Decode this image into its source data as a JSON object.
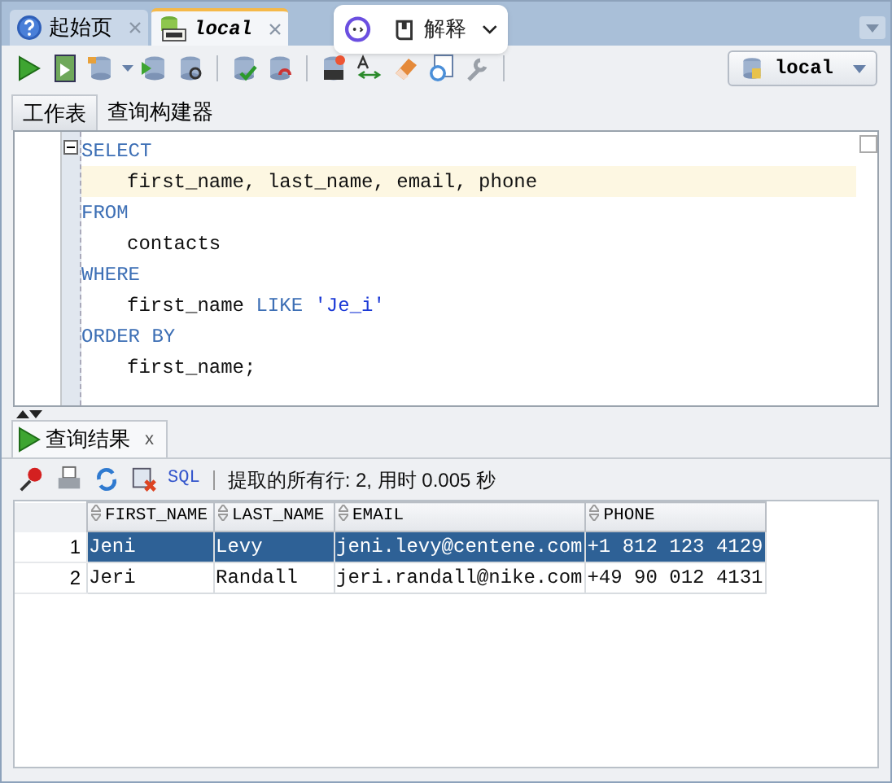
{
  "editor_tabs": [
    {
      "label": "起始页",
      "kind": "help",
      "selected": false
    },
    {
      "label": "local",
      "kind": "sql",
      "selected": true
    }
  ],
  "overlay_popup": {
    "label": "解释"
  },
  "connection": {
    "label": "local"
  },
  "sub_tabs": [
    {
      "label": "工作表",
      "selected": true
    },
    {
      "label": "查询构建器",
      "selected": false
    }
  ],
  "code_lines": [
    {
      "indented": false,
      "current": false,
      "segments": [
        {
          "text": "SELECT",
          "kind": "keyword"
        }
      ]
    },
    {
      "indented": true,
      "current": true,
      "segments": [
        {
          "text": "first_name, last_name, email, phone",
          "kind": "plain"
        }
      ]
    },
    {
      "indented": false,
      "current": false,
      "segments": [
        {
          "text": "FROM",
          "kind": "keyword"
        }
      ]
    },
    {
      "indented": true,
      "current": false,
      "segments": [
        {
          "text": "contacts",
          "kind": "plain"
        }
      ]
    },
    {
      "indented": false,
      "current": false,
      "segments": [
        {
          "text": "WHERE",
          "kind": "keyword"
        }
      ]
    },
    {
      "indented": true,
      "current": false,
      "segments": [
        {
          "text": "first_name ",
          "kind": "plain"
        },
        {
          "text": "LIKE ",
          "kind": "keyword"
        },
        {
          "text": "'Je_i'",
          "kind": "string"
        }
      ]
    },
    {
      "indented": false,
      "current": false,
      "segments": [
        {
          "text": "ORDER BY",
          "kind": "keyword"
        }
      ]
    },
    {
      "indented": true,
      "current": false,
      "segments": [
        {
          "text": "first_name;",
          "kind": "plain"
        }
      ]
    }
  ],
  "results_tab": {
    "label": "查询结果",
    "close": "x"
  },
  "results_toolbar": {
    "sql_link": "SQL",
    "status": "提取的所有行: 2, 用时 0.005 秒"
  },
  "table": {
    "columns": [
      "FIRST_NAME",
      "LAST_NAME",
      "EMAIL",
      "PHONE"
    ],
    "rows": [
      {
        "number": "1",
        "selected": true,
        "cells": [
          "Jeni",
          "Levy",
          "jeni.levy@centene.com",
          "+1 812 123 4129"
        ]
      },
      {
        "number": "2",
        "selected": false,
        "cells": [
          "Jeri",
          "Randall",
          "jeri.randall@nike.com",
          "+49 90 012 4131"
        ]
      }
    ]
  }
}
